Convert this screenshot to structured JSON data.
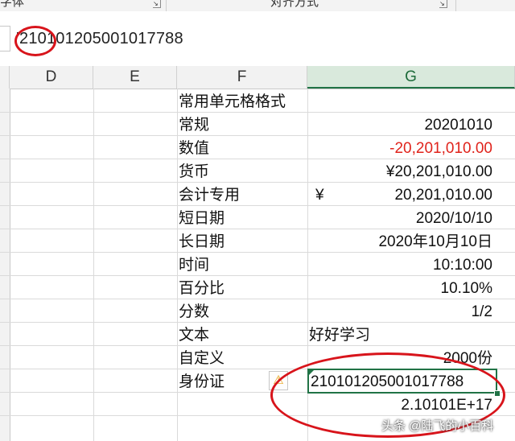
{
  "ribbon": {
    "group_font": "字体",
    "group_align": "对齐方式",
    "launcher_glyph": "↘"
  },
  "formula_bar": {
    "value": "'210101205001017788"
  },
  "columns": [
    "D",
    "E",
    "F",
    "G"
  ],
  "table": {
    "header": "常用单元格格式",
    "rows": [
      {
        "format": "常规",
        "value": "20201010"
      },
      {
        "format": "数值",
        "value": "-20,201,010.00"
      },
      {
        "format": "货币",
        "value": "¥20,201,010.00"
      },
      {
        "format": "会计专用",
        "symbol": "¥",
        "value": "20,201,010.00"
      },
      {
        "format": "短日期",
        "value": "2020/10/10"
      },
      {
        "format": "长日期",
        "value": "2020年10月10日"
      },
      {
        "format": "时间",
        "value": "10:10:00"
      },
      {
        "format": "百分比",
        "value": "10.10%"
      },
      {
        "format": "分数",
        "value": "1/2"
      },
      {
        "format": "文本",
        "value": "好好学习"
      },
      {
        "format": "自定义",
        "value": "2000份"
      },
      {
        "format": "身份证",
        "value": "210101205001017788"
      },
      {
        "format": "",
        "value": "2.10101E+17"
      }
    ]
  },
  "warning_icon": "⚠",
  "watermark": "头条 @陆飞的小百科",
  "colors": {
    "negative": "#e0231b",
    "selection": "#217346",
    "annotation": "#d8141b"
  }
}
